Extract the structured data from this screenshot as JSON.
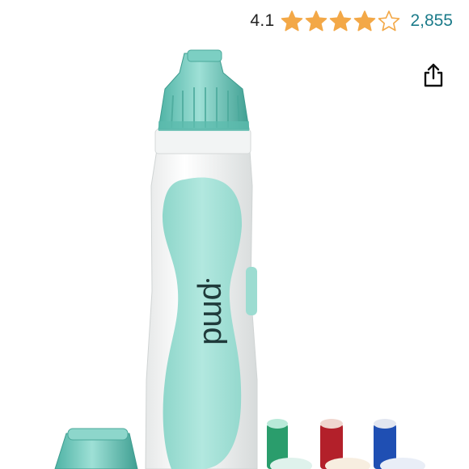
{
  "rating": {
    "value": "4.1",
    "stars_filled": 4.1,
    "stars_max": 5,
    "review_count": "2,855",
    "star_color": "#f3a847",
    "count_color": "#1b7b8a"
  },
  "share": {
    "icon": "share-icon"
  },
  "product": {
    "brand_mark": "pmd",
    "body_color": "#ffffff",
    "grip_color": "#a7e3d9",
    "cap_color": "#6dc9bb"
  }
}
